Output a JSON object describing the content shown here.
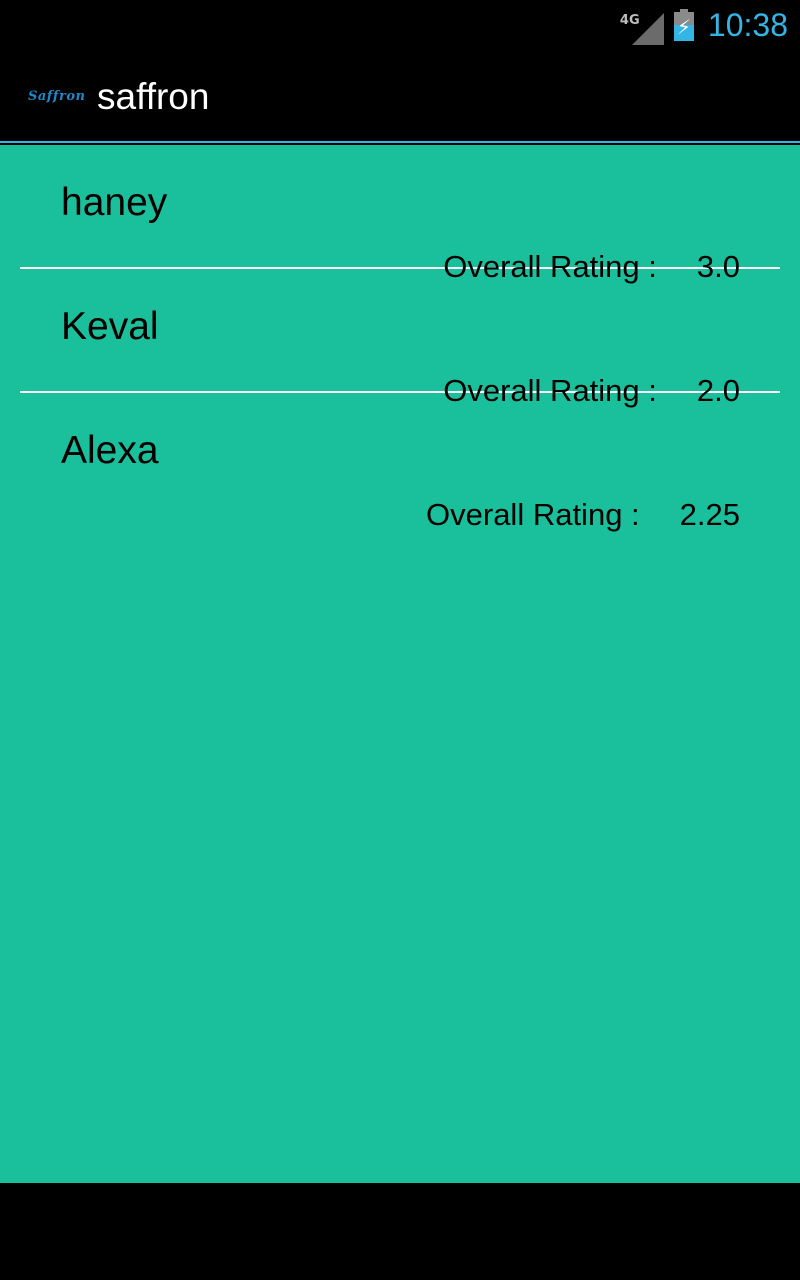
{
  "status_bar": {
    "network": "4G",
    "time": "10:38",
    "battery_level": 0.55,
    "charging": true
  },
  "action_bar": {
    "logo_text": "Saffron",
    "title": "saffron"
  },
  "list": {
    "items": [
      {
        "name": "haney",
        "rating_label": "Overall Rating :",
        "rating_value": "3.0"
      },
      {
        "name": "Keval",
        "rating_label": "Overall Rating :",
        "rating_value": "2.0"
      },
      {
        "name": "Alexa",
        "rating_label": "Overall Rating :",
        "rating_value": "2.25"
      }
    ]
  },
  "colors": {
    "accent": "#33b5e5",
    "content_background": "#1abf9b",
    "divider": "#ffffff",
    "text": "#000000"
  },
  "icons": {
    "signal": "signal-icon",
    "battery": "battery-charging-icon"
  }
}
